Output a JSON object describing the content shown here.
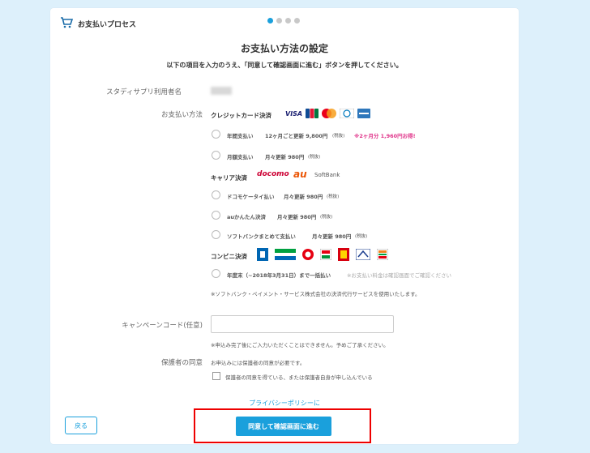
{
  "header": {
    "title": "お支払いプロセス"
  },
  "page": {
    "title": "お支払い方法の設定",
    "subtitle": "以下の項目を入力のうえ、「同意して確認画面に進む」ボタンを押してください。"
  },
  "form": {
    "user_label": "スタディサプリ利用者名",
    "payment_label": "お支払い方法",
    "credit": {
      "heading": "クレジットカード決済",
      "card_brands": [
        "VISA",
        "JCB",
        "MasterCard",
        "Diners",
        "AMEX"
      ],
      "options": [
        {
          "name": "年間支払い",
          "detail": "12ヶ月ごと更新 9,800円",
          "tax": "(税抜)",
          "promo": "※2ヶ月分 1,960円お得!"
        },
        {
          "name": "月額支払い",
          "detail": "月々更新 980円",
          "tax": "(税抜)"
        }
      ]
    },
    "carrier": {
      "heading": "キャリア決済",
      "logos": [
        "docomo",
        "au",
        "SoftBank"
      ],
      "options": [
        {
          "name": "ドコモケータイ払い",
          "detail": "月々更新 980円",
          "tax": "(税抜)"
        },
        {
          "name": "auかんたん決済",
          "detail": "月々更新 980円",
          "tax": "(税抜)"
        },
        {
          "name": "ソフトバンクまとめて支払い",
          "detail": "月々更新 980円",
          "tax": "(税抜)"
        }
      ]
    },
    "convenience": {
      "heading": "コンビニ決済",
      "options": [
        {
          "name": "年度末（~2018年3月31日）まで一括払い",
          "note": "※お支払い料金は確認画面でご確認ください"
        }
      ],
      "note": "※ソフトバンク・ペイメント・サービス株式会社の決済代行サービスを使用いたします。"
    },
    "campaign_label": "キャンペーンコード(任意)",
    "campaign_value": "",
    "campaign_note": "※申込み完了後にご入力いただくことはできません。予めご了承ください。",
    "guardian_label": "保護者の同意",
    "guardian_text": "お申込みには保護者の同意が必要です。",
    "guardian_checkbox": "保護者の同意を得ている、または保護者自身が申し込んでいる"
  },
  "footer": {
    "privacy": "プライバシーポリシーに",
    "back": "戻る",
    "agree": "同意して確認画面に進む"
  },
  "colors": {
    "accent": "#1aa0dc",
    "highlight": "#ee0000",
    "promo": "#e0348a"
  }
}
